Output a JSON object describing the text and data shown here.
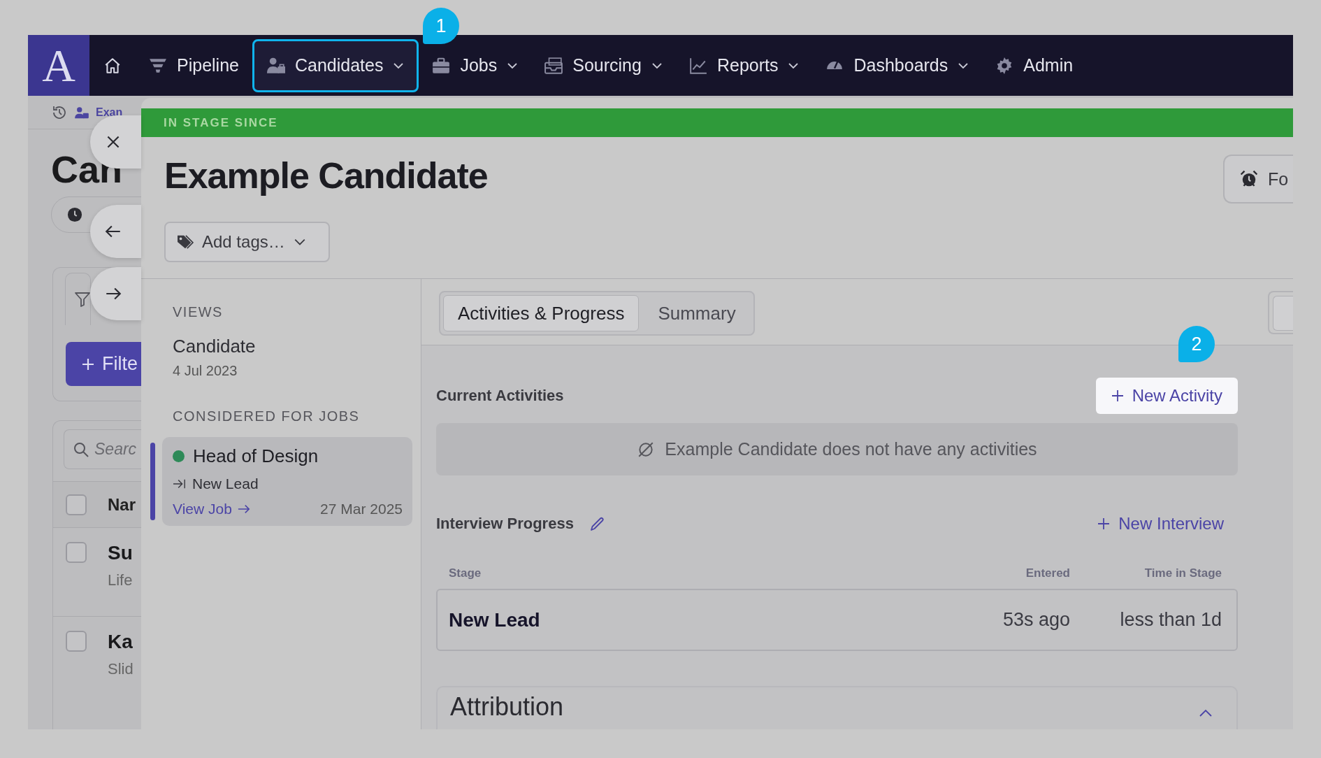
{
  "nav": {
    "logo": "A",
    "items": [
      {
        "label": "Pipeline",
        "dropdown": false,
        "selected": false
      },
      {
        "label": "Candidates",
        "dropdown": true,
        "selected": true
      },
      {
        "label": "Jobs",
        "dropdown": true,
        "selected": false
      },
      {
        "label": "Sourcing",
        "dropdown": true,
        "selected": false
      },
      {
        "label": "Reports",
        "dropdown": true,
        "selected": false
      },
      {
        "label": "Dashboards",
        "dropdown": true,
        "selected": false
      },
      {
        "label": "Admin",
        "dropdown": false,
        "selected": false
      }
    ]
  },
  "callouts": [
    {
      "label": "1"
    },
    {
      "label": "2"
    }
  ],
  "background_page": {
    "breadcrumb": "Exan",
    "heading": "Can",
    "filter_button": "Filte",
    "search": {
      "placeholder": "Searc"
    },
    "table": {
      "column": "Nar",
      "header_checked": false,
      "rows": [
        {
          "name": "Su",
          "subtitle": "Life",
          "checked": false
        },
        {
          "name": "Ka",
          "subtitle": "Slid",
          "checked": false
        }
      ]
    }
  },
  "drawer": {
    "stage_banner": "IN STAGE SINCE",
    "title": "Example Candidate",
    "tags_button": "Add tags…",
    "follow_button": "Fo",
    "views": {
      "heading": "VIEWS",
      "items": [
        {
          "title": "Candidate",
          "date": "4 Jul 2023"
        }
      ]
    },
    "jobs": {
      "heading": "CONSIDERED FOR JOBS",
      "items": [
        {
          "title": "Head of Design",
          "color": "#2e8a58",
          "stage": "New Lead",
          "link": "View Job",
          "date": "27 Mar 2025",
          "selected": true
        }
      ]
    },
    "tabs": [
      {
        "label": "Activities & Progress",
        "selected": true
      },
      {
        "label": "Summary",
        "selected": false
      }
    ],
    "activities": {
      "heading": "Current Activities",
      "button": "New Activity",
      "empty": "Example Candidate does not have any activities"
    },
    "interview": {
      "heading": "Interview Progress",
      "button": "New Interview",
      "columns": [
        "Stage",
        "Entered",
        "Time in Stage"
      ],
      "rows": [
        {
          "stage": "New Lead",
          "entered": "53s ago",
          "time": "less than 1d"
        }
      ]
    },
    "attribution": {
      "title": "Attribution",
      "expanded": true
    }
  }
}
